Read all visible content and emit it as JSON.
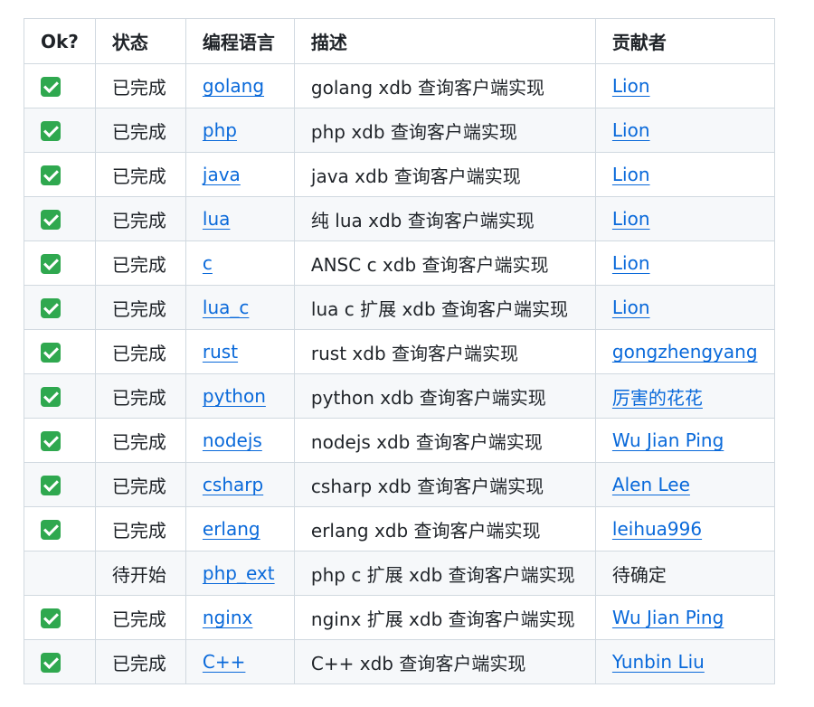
{
  "headers": [
    "Ok?",
    "状态",
    "编程语言",
    "描述",
    "贡献者"
  ],
  "rows": [
    {
      "ok": true,
      "status": "已完成",
      "lang": "golang",
      "desc": "golang xdb 查询客户端实现",
      "contributor": "Lion",
      "contributor_link": true
    },
    {
      "ok": true,
      "status": "已完成",
      "lang": "php",
      "desc": "php xdb 查询客户端实现",
      "contributor": "Lion",
      "contributor_link": true
    },
    {
      "ok": true,
      "status": "已完成",
      "lang": "java",
      "desc": "java xdb 查询客户端实现",
      "contributor": "Lion",
      "contributor_link": true
    },
    {
      "ok": true,
      "status": "已完成",
      "lang": "lua",
      "desc": "纯 lua xdb 查询客户端实现",
      "contributor": "Lion",
      "contributor_link": true
    },
    {
      "ok": true,
      "status": "已完成",
      "lang": "c",
      "desc": "ANSC c xdb 查询客户端实现",
      "contributor": "Lion",
      "contributor_link": true
    },
    {
      "ok": true,
      "status": "已完成",
      "lang": "lua_c",
      "desc": "lua c 扩展 xdb 查询客户端实现",
      "contributor": "Lion",
      "contributor_link": true
    },
    {
      "ok": true,
      "status": "已完成",
      "lang": "rust",
      "desc": "rust xdb 查询客户端实现",
      "contributor": "gongzhengyang",
      "contributor_link": true
    },
    {
      "ok": true,
      "status": "已完成",
      "lang": "python",
      "desc": "python xdb 查询客户端实现",
      "contributor": "厉害的花花",
      "contributor_link": true
    },
    {
      "ok": true,
      "status": "已完成",
      "lang": "nodejs",
      "desc": "nodejs xdb 查询客户端实现",
      "contributor": "Wu Jian Ping",
      "contributor_link": true
    },
    {
      "ok": true,
      "status": "已完成",
      "lang": "csharp",
      "desc": "csharp xdb 查询客户端实现",
      "contributor": "Alen Lee",
      "contributor_link": true
    },
    {
      "ok": true,
      "status": "已完成",
      "lang": "erlang",
      "desc": "erlang xdb 查询客户端实现",
      "contributor": "leihua996",
      "contributor_link": true
    },
    {
      "ok": false,
      "status": "待开始",
      "lang": "php_ext",
      "desc": "php c 扩展 xdb 查询客户端实现",
      "contributor": "待确定",
      "contributor_link": false
    },
    {
      "ok": true,
      "status": "已完成",
      "lang": "nginx",
      "desc": "nginx 扩展 xdb 查询客户端实现",
      "contributor": "Wu Jian Ping",
      "contributor_link": true
    },
    {
      "ok": true,
      "status": "已完成",
      "lang": "C++",
      "desc": "C++ xdb 查询客户端实现",
      "contributor": "Yunbin Liu",
      "contributor_link": true
    }
  ],
  "icons": {
    "done": "check-mark-button-icon"
  },
  "colors": {
    "link": "#0969da",
    "check": "#2fa84f",
    "border": "#d1d9e0",
    "zebra": "#f6f8fa"
  }
}
